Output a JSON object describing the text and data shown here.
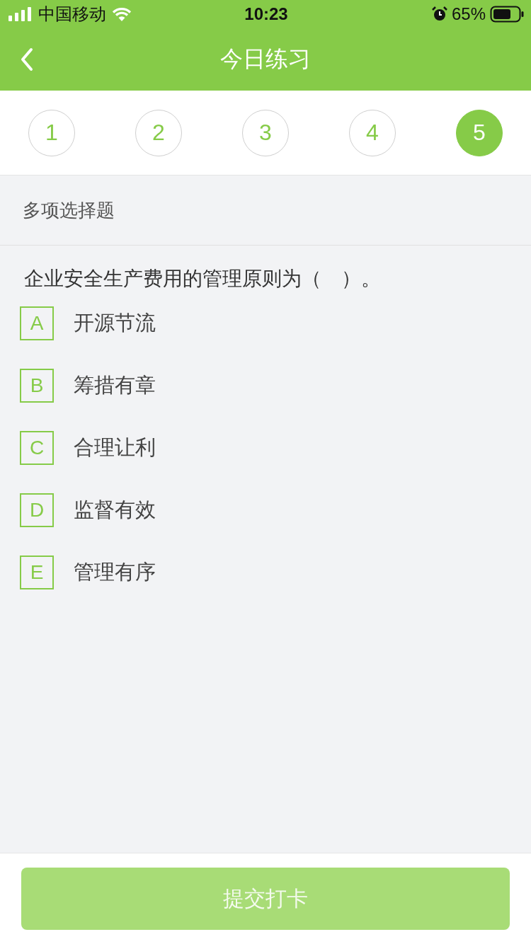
{
  "status_bar": {
    "carrier": "中国移动",
    "time": "10:23",
    "battery_text": "65%"
  },
  "header": {
    "title": "今日练习"
  },
  "steps": [
    {
      "label": "1",
      "selected": false
    },
    {
      "label": "2",
      "selected": false
    },
    {
      "label": "3",
      "selected": false
    },
    {
      "label": "4",
      "selected": false
    },
    {
      "label": "5",
      "selected": true
    }
  ],
  "section_title": "多项选择题",
  "question": "企业安全生产费用的管理原则为（　）。",
  "options": [
    {
      "letter": "A",
      "text": "开源节流",
      "selected": false
    },
    {
      "letter": "B",
      "text": "筹措有章",
      "selected": false
    },
    {
      "letter": "C",
      "text": "合理让利",
      "selected": false
    },
    {
      "letter": "D",
      "text": "监督有效",
      "selected": false
    },
    {
      "letter": "E",
      "text": "管理有序",
      "selected": false
    }
  ],
  "submit_button": {
    "label": "提交打卡",
    "disabled": true
  }
}
